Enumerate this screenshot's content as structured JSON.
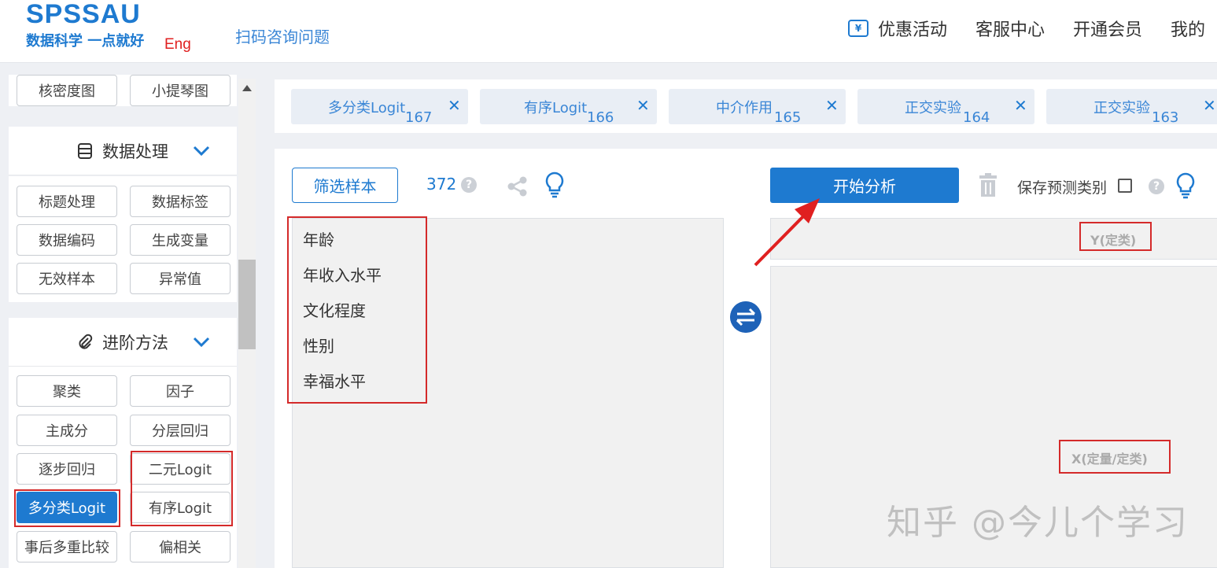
{
  "header": {
    "logo_main": "SPSSAU",
    "logo_sub": "数据科学 一点就好",
    "logo_lang": "Eng",
    "scan_link": "扫码咨询问题",
    "nav": [
      "优惠活动",
      "客服中心",
      "开通会员",
      "我的"
    ]
  },
  "sidebar": {
    "top_buttons": [
      "核密度图",
      "小提琴图"
    ],
    "data_section": {
      "title": "数据处理",
      "items": [
        "标题处理",
        "数据标签",
        "数据编码",
        "生成变量",
        "无效样本",
        "异常值"
      ]
    },
    "advanced_section": {
      "title": "进阶方法",
      "items": [
        "聚类",
        "因子",
        "主成分",
        "分层回归",
        "逐步回归",
        "二元Logit",
        "多分类Logit",
        "有序Logit",
        "事后多重比较",
        "偏相关"
      ],
      "active_item": "多分类Logit"
    }
  },
  "tabs": [
    {
      "label": "多分类Logit",
      "num": "167"
    },
    {
      "label": "有序Logit",
      "num": "166"
    },
    {
      "label": "中介作用",
      "num": "165"
    },
    {
      "label": "正交实验",
      "num": "164"
    },
    {
      "label": "正交实验",
      "num": "163"
    }
  ],
  "toolbar": {
    "filter_label": "筛选样本",
    "sample_count": "372",
    "start_label": "开始分析",
    "save_pred_label": "保存预测类别"
  },
  "variables": [
    "年龄",
    "年收入水平",
    "文化程度",
    "性别",
    "幸福水平"
  ],
  "drop_zones": {
    "y_label": "Y(定类)",
    "x_label": "X(定量/定类)"
  },
  "watermark": "知乎 @今儿个学习",
  "colors": {
    "accent": "#1e7ad0",
    "highlight_red": "#d42a2a"
  }
}
